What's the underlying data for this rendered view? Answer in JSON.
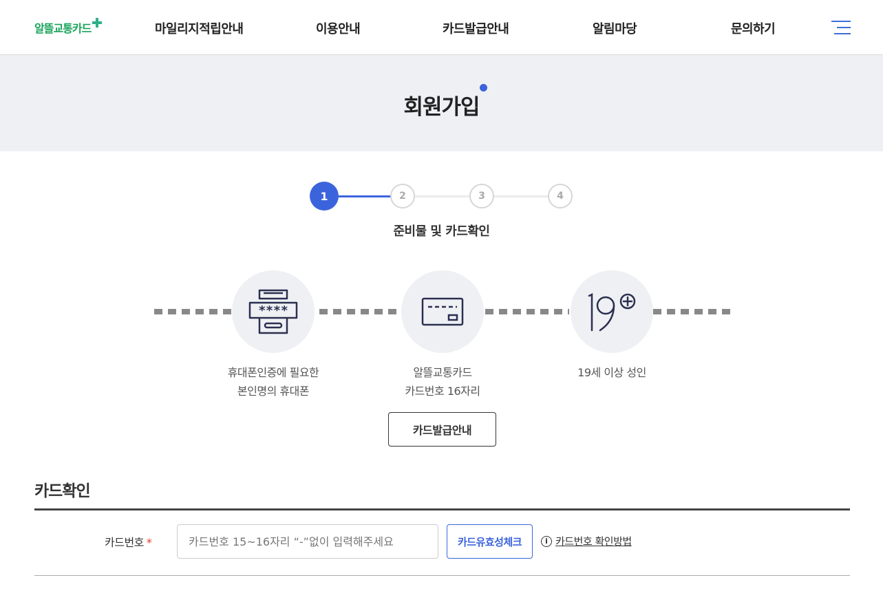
{
  "header": {
    "logo_text": "알뜰교통카드",
    "nav": [
      {
        "label": "마일리지적립안내"
      },
      {
        "label": "이용안내"
      },
      {
        "label": "카드발급안내"
      },
      {
        "label": "알림마당"
      },
      {
        "label": "문의하기"
      }
    ],
    "menu_icon": "hamburger-menu-icon"
  },
  "page": {
    "title": "회원가입"
  },
  "stepper": {
    "steps": [
      "1",
      "2",
      "3",
      "4"
    ],
    "current_step": 1,
    "current_label": "준비물 및 카드확인"
  },
  "requirements": [
    {
      "icon": "phone-password-icon",
      "line1": "휴대폰인증에 필요한",
      "line2": "본인명의 휴대폰"
    },
    {
      "icon": "card-icon",
      "line1": "알뜰교통카드",
      "line2": "카드번호 16자리"
    },
    {
      "icon": "adult-19-plus-icon",
      "line1": "19세 이상 성인",
      "line2": ""
    }
  ],
  "guide_button": "카드발급안내",
  "card_check": {
    "section_title": "카드확인",
    "field_label": "카드번호",
    "required_mark": "*",
    "input_placeholder": "카드번호 15~16자리 “-”없이 입력해주세요",
    "input_value": "",
    "check_button": "카드유효성체크",
    "howto_link": "카드번호 확인방법"
  },
  "colors": {
    "accent": "#3b64dc",
    "band_bg": "#eef0f4",
    "required": "#e03a1e",
    "logo_green": "#1aa35b"
  }
}
